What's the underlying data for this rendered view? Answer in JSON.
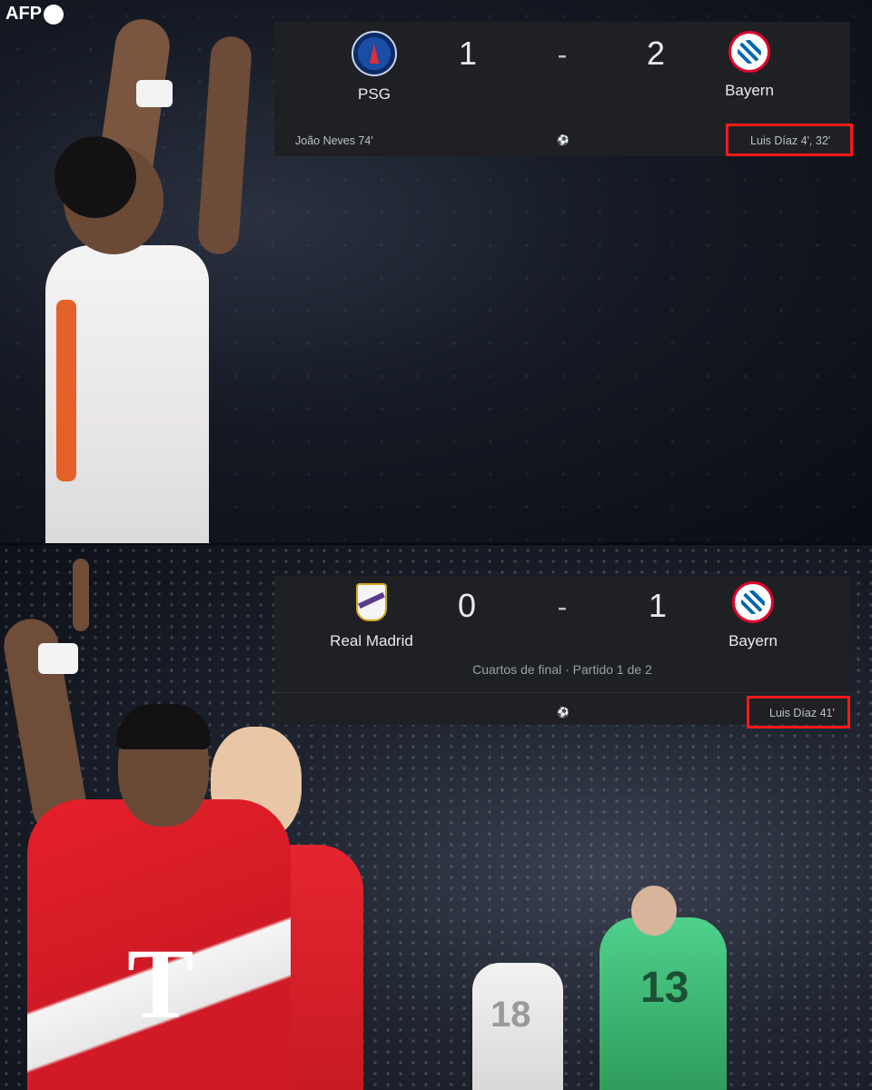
{
  "watermark": {
    "brand": "AFP"
  },
  "match1": {
    "home": {
      "name": "PSG",
      "score": "1",
      "crest": "psg-crest-icon"
    },
    "away": {
      "name": "Bayern",
      "score": "2",
      "crest": "bayern-crest-icon"
    },
    "separator": "-",
    "home_scorers": "João Neves 74'",
    "away_scorers": "Luis Díaz 4', 32'",
    "ball_icon": "⚽"
  },
  "match2": {
    "home": {
      "name": "Real Madrid",
      "score": "0",
      "crest": "real-madrid-crest-icon"
    },
    "away": {
      "name": "Bayern",
      "score": "1",
      "crest": "bayern-crest-icon"
    },
    "separator": "-",
    "stage": "Cuartos de final · Partido 1 de 2",
    "away_scorers": "Luis Díaz 41'",
    "ball_icon": "⚽"
  },
  "colors": {
    "highlight": "#ff1a1a",
    "card_bg": "#1f2024",
    "bayern_red": "#dc052d"
  },
  "photo_details": {
    "keeper_number": "13",
    "outfield_number": "18"
  }
}
